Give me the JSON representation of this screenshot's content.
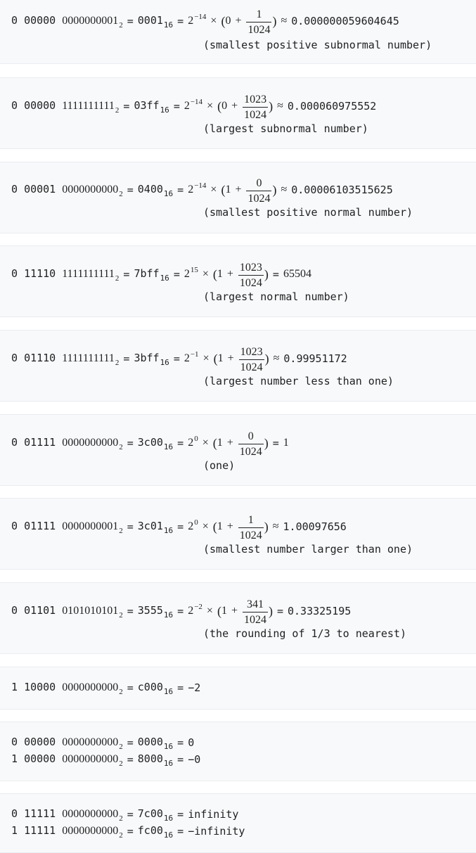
{
  "entries": [
    {
      "sign": "0",
      "exp": "00000",
      "mant": "0000000001",
      "sub2": "2",
      "hex": "0001",
      "sub16": "16",
      "base": "2",
      "exponent": "−14",
      "lead": "0",
      "num": "1",
      "den": "1024",
      "rel": "≈",
      "value": "0.000000059604645",
      "note": "(smallest positive subnormal number)"
    },
    {
      "sign": "0",
      "exp": "00000",
      "mant": "1111111111",
      "sub2": "2",
      "hex": "03ff",
      "sub16": "16",
      "base": "2",
      "exponent": "−14",
      "lead": "0",
      "num": "1023",
      "den": "1024",
      "rel": "≈",
      "value": "0.000060975552",
      "note": "(largest subnormal number)"
    },
    {
      "sign": "0",
      "exp": "00001",
      "mant": "0000000000",
      "sub2": "2",
      "hex": "0400",
      "sub16": "16",
      "base": "2",
      "exponent": "−14",
      "lead": "1",
      "num": "0",
      "den": "1024",
      "rel": "≈",
      "value": "0.00006103515625",
      "note": "(smallest positive normal number)"
    },
    {
      "sign": "0",
      "exp": "11110",
      "mant": "1111111111",
      "sub2": "2",
      "hex": "7bff",
      "sub16": "16",
      "base": "2",
      "exponent": "15",
      "lead": "1",
      "num": "1023",
      "den": "1024",
      "rel": "=",
      "value": "65504",
      "note": "(largest normal number)"
    },
    {
      "sign": "0",
      "exp": "01110",
      "mant": "1111111111",
      "sub2": "2",
      "hex": "3bff",
      "sub16": "16",
      "base": "2",
      "exponent": "−1",
      "lead": "1",
      "num": "1023",
      "den": "1024",
      "rel": "≈",
      "value": "0.99951172",
      "note": "(largest number less than one)"
    },
    {
      "sign": "0",
      "exp": "01111",
      "mant": "0000000000",
      "sub2": "2",
      "hex": "3c00",
      "sub16": "16",
      "base": "2",
      "exponent": "0",
      "lead": "1",
      "num": "0",
      "den": "1024",
      "rel": "=",
      "value": "1",
      "note": "(one)"
    },
    {
      "sign": "0",
      "exp": "01111",
      "mant": "0000000001",
      "sub2": "2",
      "hex": "3c01",
      "sub16": "16",
      "base": "2",
      "exponent": "0",
      "lead": "1",
      "num": "1",
      "den": "1024",
      "rel": "≈",
      "value": "1.00097656",
      "note": "(smallest number larger than one)"
    },
    {
      "sign": "0",
      "exp": "01101",
      "mant": "0101010101",
      "sub2": "2",
      "hex": "3555",
      "sub16": "16",
      "base": "2",
      "exponent": "−2",
      "lead": "1",
      "num": "341",
      "den": "1024",
      "rel": "=",
      "value": "0.33325195",
      "note": "(the rounding of 1/3 to nearest)"
    }
  ],
  "simple": [
    {
      "sign": "1",
      "exp": "10000",
      "mant": "0000000000",
      "sub2": "2",
      "hex": "c000",
      "sub16": "16",
      "value": "−2"
    },
    {
      "sign": "0",
      "exp": "00000",
      "mant": "0000000000",
      "sub2": "2",
      "hex": "0000",
      "sub16": "16",
      "value": "0"
    },
    {
      "sign": "1",
      "exp": "00000",
      "mant": "0000000000",
      "sub2": "2",
      "hex": "8000",
      "sub16": "16",
      "value": "−0"
    },
    {
      "sign": "0",
      "exp": "11111",
      "mant": "0000000000",
      "sub2": "2",
      "hex": "7c00",
      "sub16": "16",
      "value": "infinity"
    },
    {
      "sign": "1",
      "exp": "11111",
      "mant": "0000000000",
      "sub2": "2",
      "hex": "fc00",
      "sub16": "16",
      "value": "−infinity"
    }
  ],
  "symbols": {
    "eq": "=",
    "times": "×",
    "plus": "+",
    "lparen": "(",
    "rparen": ")"
  }
}
